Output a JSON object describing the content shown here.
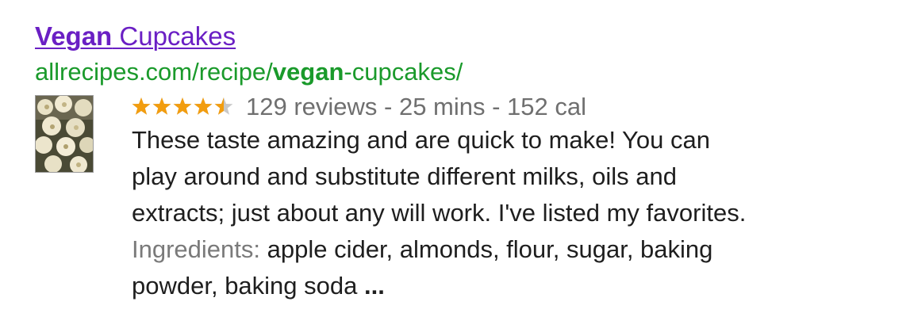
{
  "result": {
    "title_bold": "Vegan",
    "title_rest": " Cupcakes",
    "url_prefix": "allrecipes.com/recipe/",
    "url_bold": "vegan",
    "url_suffix": "-cupcakes/",
    "thumbnail_icon": "cupcakes-photo",
    "rating": {
      "value": 4.5,
      "max": 5,
      "star_color": "#f29d0f",
      "empty_star_color": "#c8c8c8",
      "icon": "star-icon"
    },
    "meta_text": "129 reviews - 25 mins - 152 cal",
    "description": "These taste amazing and are quick to make! You can\nplay around and substitute different milks, oils and\nextracts; just about any will work. I've listed my favorites.",
    "ingredients_label": "Ingredients:",
    "ingredients_text": " apple cider, almonds, flour, sugar, baking\npowder, baking soda ",
    "ellipsis": "...",
    "colors": {
      "title": "#6a1fc4",
      "url": "#1a9a2b",
      "meta": "#6f6f6f",
      "text": "#1e1e1e"
    }
  }
}
